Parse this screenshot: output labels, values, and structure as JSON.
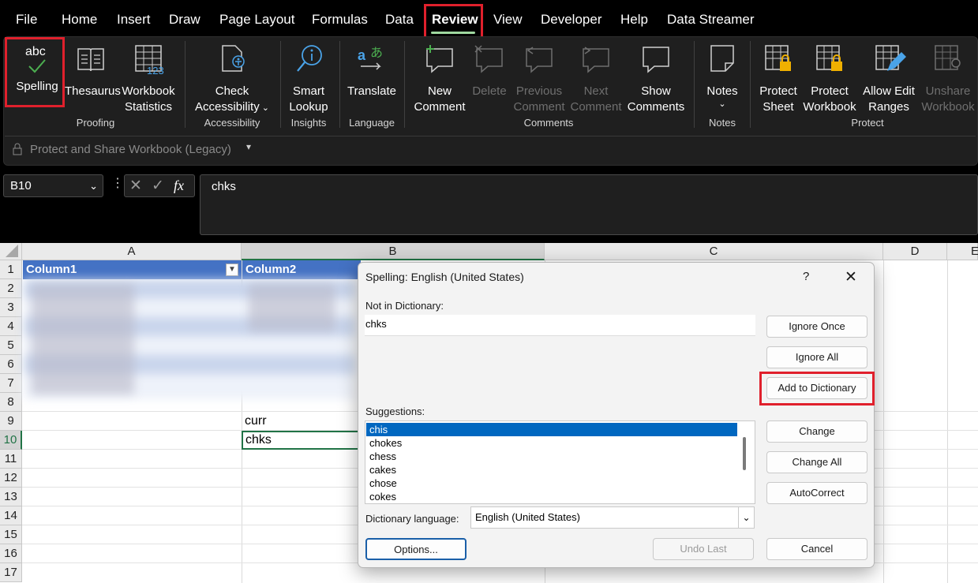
{
  "menu": {
    "tabs": [
      "File",
      "Home",
      "Insert",
      "Draw",
      "Page Layout",
      "Formulas",
      "Data",
      "Review",
      "View",
      "Developer",
      "Help",
      "Data Streamer"
    ],
    "active": "Review"
  },
  "ribbon": {
    "proofing": {
      "spelling": "Spelling",
      "thesaurus": "Thesaurus",
      "workbook_stats_1": "Workbook",
      "workbook_stats_2": "Statistics",
      "group": "Proofing",
      "abc": "abc"
    },
    "accessibility": {
      "check_1": "Check",
      "check_2": "Accessibility",
      "group": "Accessibility"
    },
    "insights": {
      "smart_1": "Smart",
      "smart_2": "Lookup",
      "group": "Insights"
    },
    "language": {
      "translate": "Translate",
      "group": "Language"
    },
    "comments": {
      "new_1": "New",
      "new_2": "Comment",
      "delete": "Delete",
      "prev_1": "Previous",
      "prev_2": "Comment",
      "next_1": "Next",
      "next_2": "Comment",
      "show_1": "Show",
      "show_2": "Comments",
      "group": "Comments"
    },
    "notes": {
      "notes": "Notes",
      "group": "Notes"
    },
    "protect": {
      "sheet_1": "Protect",
      "sheet_2": "Sheet",
      "wb_1": "Protect",
      "wb_2": "Workbook",
      "ranges_1": "Allow Edit",
      "ranges_2": "Ranges",
      "unshare_1": "Unshare",
      "unshare_2": "Workbook",
      "group": "Protect"
    },
    "legacy": "Protect and Share Workbook (Legacy)"
  },
  "formula_bar": {
    "name_box": "B10",
    "formula": "chks",
    "fx": "fx"
  },
  "grid": {
    "columns": [
      "A",
      "B",
      "C",
      "D",
      "E"
    ],
    "rows": [
      "1",
      "2",
      "3",
      "4",
      "5",
      "6",
      "7",
      "8",
      "9",
      "10",
      "11",
      "12",
      "13",
      "14",
      "15",
      "16",
      "17"
    ],
    "header1": "Column1",
    "header2": "Column2",
    "b9": "curr",
    "b10": "chks"
  },
  "dialog": {
    "title": "Spelling: English (United States)",
    "help": "?",
    "not_in_dictionary_label": "Not in Dictionary:",
    "not_in_dictionary_value": "chks",
    "suggestions_label": "Suggestions:",
    "suggestions": [
      "chis",
      "chokes",
      "chess",
      "cakes",
      "chose",
      "cokes"
    ],
    "dictionary_language_label": "Dictionary language:",
    "dictionary_language": "English (United States)",
    "buttons": {
      "ignore_once": "Ignore Once",
      "ignore_all": "Ignore All",
      "add_to_dictionary": "Add to Dictionary",
      "change": "Change",
      "change_all": "Change All",
      "autocorrect": "AutoCorrect",
      "options": "Options...",
      "undo_last": "Undo Last",
      "cancel": "Cancel"
    }
  },
  "colors": {
    "highlight": "#e0202c",
    "table_header": "#4472c4",
    "selection": "#217346",
    "accent_green": "#9fd89f",
    "selected_suggestion": "#0067c0"
  }
}
